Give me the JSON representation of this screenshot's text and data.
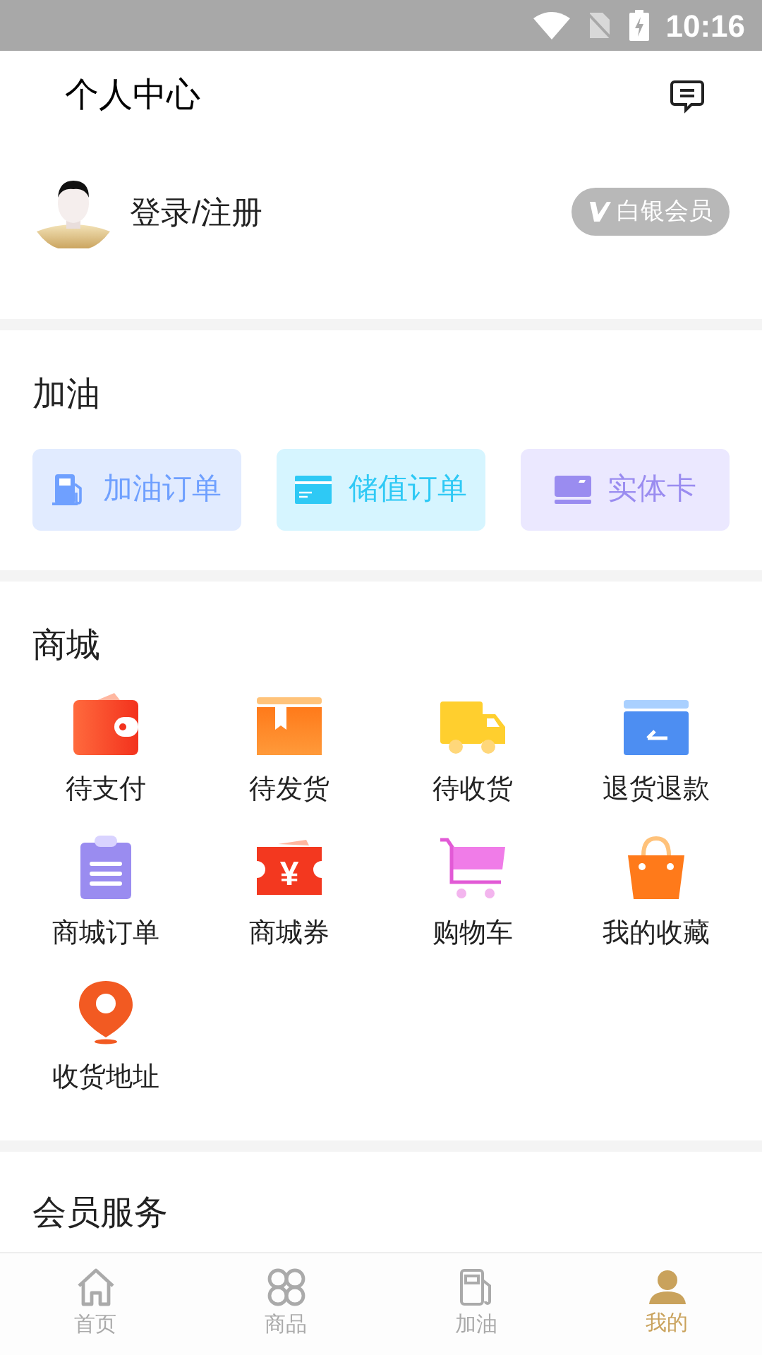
{
  "status_bar": {
    "time": "10:16"
  },
  "header": {
    "title": "个人中心"
  },
  "profile": {
    "login": "登录/注册",
    "badge": "白银会员"
  },
  "fuel": {
    "title": "加油",
    "buttons": [
      {
        "kind": "pump",
        "label": "加油订单",
        "color": "#6fa0ff"
      },
      {
        "kind": "card",
        "label": "储值订单",
        "color": "#2ec9f5"
      },
      {
        "kind": "physical",
        "label": "实体卡",
        "color": "#9a8cf0"
      }
    ]
  },
  "mall": {
    "title": "商城",
    "items": [
      {
        "kind": "wallet",
        "label": "待支付"
      },
      {
        "kind": "box",
        "label": "待发货"
      },
      {
        "kind": "truck",
        "label": "待收货"
      },
      {
        "kind": "refund",
        "label": "退货退款"
      },
      {
        "kind": "clipboard",
        "label": "商城订单"
      },
      {
        "kind": "coupon",
        "label": "商城券",
        "glyph": "¥"
      },
      {
        "kind": "cart",
        "label": "购物车"
      },
      {
        "kind": "bag",
        "label": "我的收藏"
      },
      {
        "kind": "pin",
        "label": "收货地址"
      }
    ]
  },
  "member": {
    "title": "会员服务"
  },
  "tabs": [
    {
      "kind": "home",
      "label": "首页",
      "selected": false
    },
    {
      "kind": "goods",
      "label": "商品",
      "selected": false
    },
    {
      "kind": "fuel",
      "label": "加油",
      "selected": false
    },
    {
      "kind": "me",
      "label": "我的",
      "selected": true
    }
  ]
}
